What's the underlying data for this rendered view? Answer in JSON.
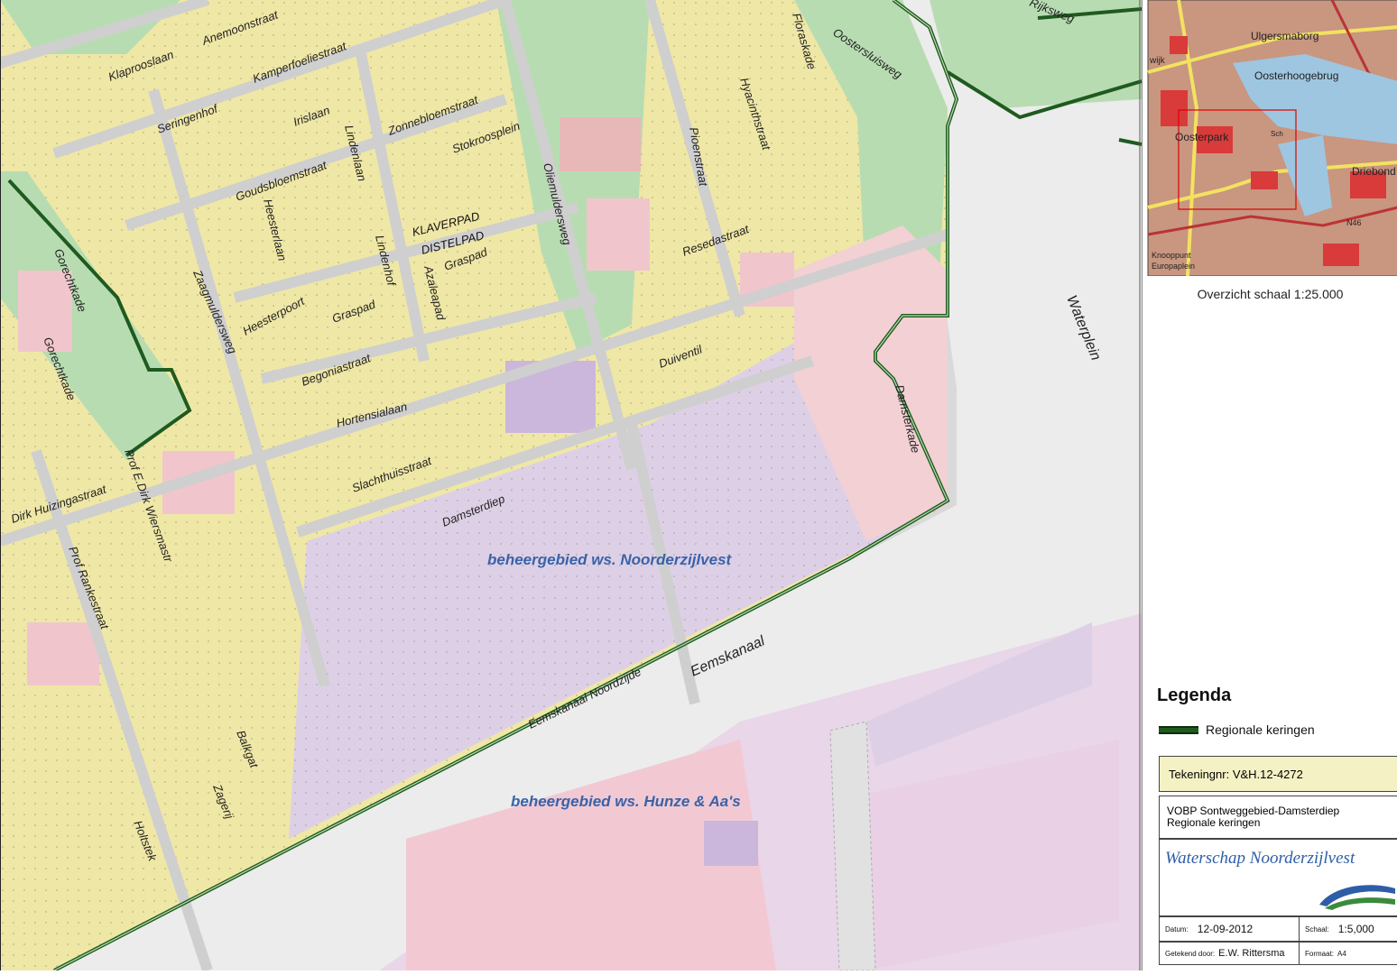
{
  "map": {
    "streets": [
      "Klaprooslaan",
      "Anemoonstraat",
      "Kamperfoeliestraat",
      "Seringenhof",
      "Irislaan",
      "Zonnebloemstraat",
      "Stokroosplein",
      "Lindenlaan",
      "Goudsbloemstraat",
      "Heesterlaan",
      "KLAVERPAD",
      "DISTELPAD",
      "Graspad",
      "Graspad",
      "Lindenhof",
      "Azaleapad",
      "Heesterpoort",
      "Zaagmuldersweg",
      "Begoniastraat",
      "Hortensialaan",
      "Slachthuisstraat",
      "Damsterdiep",
      "Oliemuldersweg",
      "Floraskade",
      "Oostersluisweg",
      "Hyacinthstraat",
      "Pioenstraat",
      "Resedastraat",
      "Duiventil",
      "Damsterkade",
      "Gorechtkade",
      "Gorechtkade",
      "Dirk Huizingastraat",
      "Prof E.Dirk Wiersmastr",
      "Prof Rankestraat",
      "Balkgat",
      "Zagerij",
      "Holtstek",
      "Eemskanaal Noordzijde",
      "Rijksweg"
    ],
    "water_labels": [
      "Waterplein",
      "Eemskanaal"
    ],
    "zone_labels": [
      "beheergebied ws. Noorderzijlvest",
      "beheergebied ws. Hunze & Aa's"
    ]
  },
  "overview": {
    "labels": [
      "Ulgersmaborg",
      "Oosterhoogebrug",
      "Oosterpark",
      "Sch",
      "Driebond",
      "N46",
      "Knooppunt",
      "Europaplein",
      "wijk"
    ],
    "caption": "Overzicht schaal 1:25.000"
  },
  "legend": {
    "title": "Legenda",
    "items": [
      {
        "label": "Regionale keringen",
        "color": "#1f5a1f"
      }
    ]
  },
  "title_block": {
    "drawing_no": "Tekeningnr:  V&H.12-4272",
    "title_line1": "VOBP Sontweggebied-Damsterdiep",
    "title_line2": "Regionale keringen",
    "org_name": "Waterschap Noorderzijlvest",
    "datum_label": "Datum:",
    "datum": "12-09-2012",
    "schaal_label": "Schaal:",
    "schaal": "1:5,000",
    "getekend_label": "Getekend door:",
    "getekend": "E.W. Rittersma",
    "formaat_label": "Formaat:",
    "formaat": "A4"
  },
  "colors": {
    "residential": "#f3ecb0",
    "green": "#b8dcb2",
    "commercial": "#f0c6cc",
    "industrial": "#ddd0e6",
    "road": "#cfcfcf",
    "water": "#ececec",
    "levee": "#1f5a1f",
    "zone_label": "#3a62a8"
  }
}
